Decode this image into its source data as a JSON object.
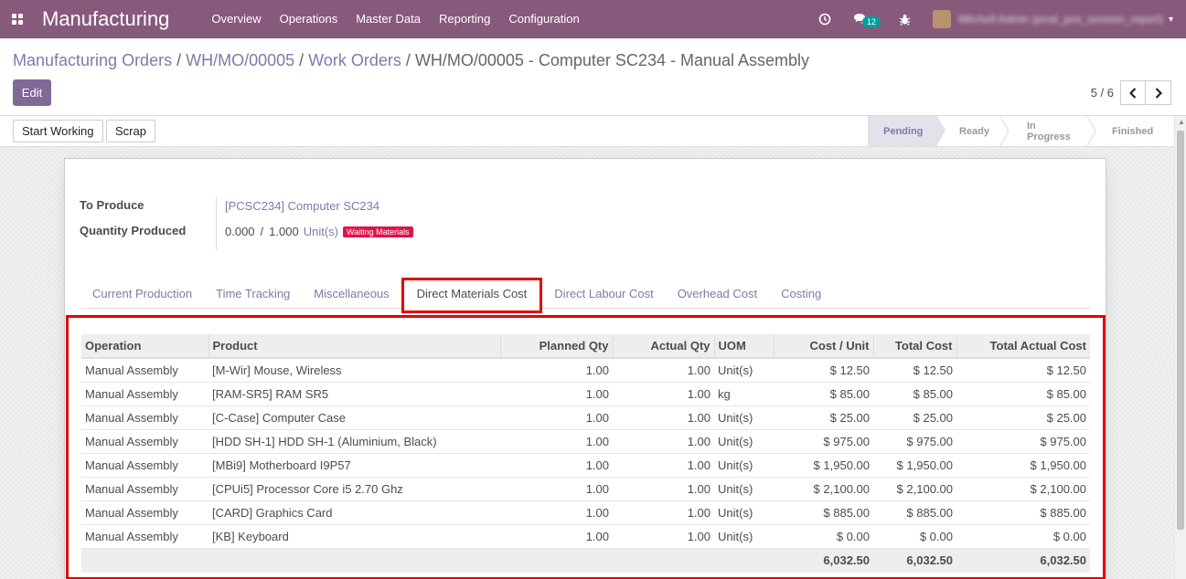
{
  "navbar": {
    "app_name": "Manufacturing",
    "menu": [
      "Overview",
      "Operations",
      "Master Data",
      "Reporting",
      "Configuration"
    ],
    "messages_count": "12",
    "user_name": "Mitchell Admin (prod_pos_session_report)",
    "color": "#875a7b"
  },
  "breadcrumb": {
    "items": [
      "Manufacturing Orders",
      "WH/MO/00005",
      "Work Orders"
    ],
    "current": "WH/MO/00005 - Computer SC234 - Manual Assembly"
  },
  "control": {
    "edit_label": "Edit",
    "pager": "5 / 6"
  },
  "header": {
    "buttons": [
      "Start Working",
      "Scrap"
    ],
    "stages": [
      "Pending",
      "Ready",
      "In Progress",
      "Finished"
    ],
    "active_stage": "Pending"
  },
  "form": {
    "to_produce_label": "To Produce",
    "to_produce_value": "[PCSC234] Computer SC234",
    "qty_label": "Quantity Produced",
    "qty_produced": "0.000",
    "qty_sep": "/",
    "qty_total": "1.000",
    "qty_uom": "Unit(s)",
    "state_badge": "Waiting Materials"
  },
  "tabs": [
    "Current Production",
    "Time Tracking",
    "Miscellaneous",
    "Direct Materials Cost",
    "Direct Labour Cost",
    "Overhead Cost",
    "Costing"
  ],
  "active_tab": "Direct Materials Cost",
  "table": {
    "columns": [
      "Operation",
      "Product",
      "Planned Qty",
      "Actual Qty",
      "UOM",
      "Cost / Unit",
      "Total Cost",
      "Total Actual Cost"
    ],
    "rows": [
      [
        "Manual Assembly",
        "[M-Wir] Mouse, Wireless",
        "1.00",
        "1.00",
        "Unit(s)",
        "$ 12.50",
        "$ 12.50",
        "$ 12.50"
      ],
      [
        "Manual Assembly",
        "[RAM-SR5] RAM SR5",
        "1.00",
        "1.00",
        "kg",
        "$ 85.00",
        "$ 85.00",
        "$ 85.00"
      ],
      [
        "Manual Assembly",
        "[C-Case] Computer Case",
        "1.00",
        "1.00",
        "Unit(s)",
        "$ 25.00",
        "$ 25.00",
        "$ 25.00"
      ],
      [
        "Manual Assembly",
        "[HDD SH-1] HDD SH-1 (Aluminium, Black)",
        "1.00",
        "1.00",
        "Unit(s)",
        "$ 975.00",
        "$ 975.00",
        "$ 975.00"
      ],
      [
        "Manual Assembly",
        "[MBi9] Motherboard I9P57",
        "1.00",
        "1.00",
        "Unit(s)",
        "$ 1,950.00",
        "$ 1,950.00",
        "$ 1,950.00"
      ],
      [
        "Manual Assembly",
        "[CPUi5] Processor Core i5 2.70 Ghz",
        "1.00",
        "1.00",
        "Unit(s)",
        "$ 2,100.00",
        "$ 2,100.00",
        "$ 2,100.00"
      ],
      [
        "Manual Assembly",
        "[CARD] Graphics Card",
        "1.00",
        "1.00",
        "Unit(s)",
        "$ 885.00",
        "$ 885.00",
        "$ 885.00"
      ],
      [
        "Manual Assembly",
        "[KB] Keyboard",
        "1.00",
        "1.00",
        "Unit(s)",
        "$ 0.00",
        "$ 0.00",
        "$ 0.00"
      ]
    ],
    "totals": [
      "",
      "",
      "",
      "",
      "",
      "6,032.50",
      "6,032.50",
      "6,032.50"
    ]
  },
  "colors": {
    "highlight": "#e40000",
    "link": "#7c7bad",
    "badge": "#e0124a"
  }
}
